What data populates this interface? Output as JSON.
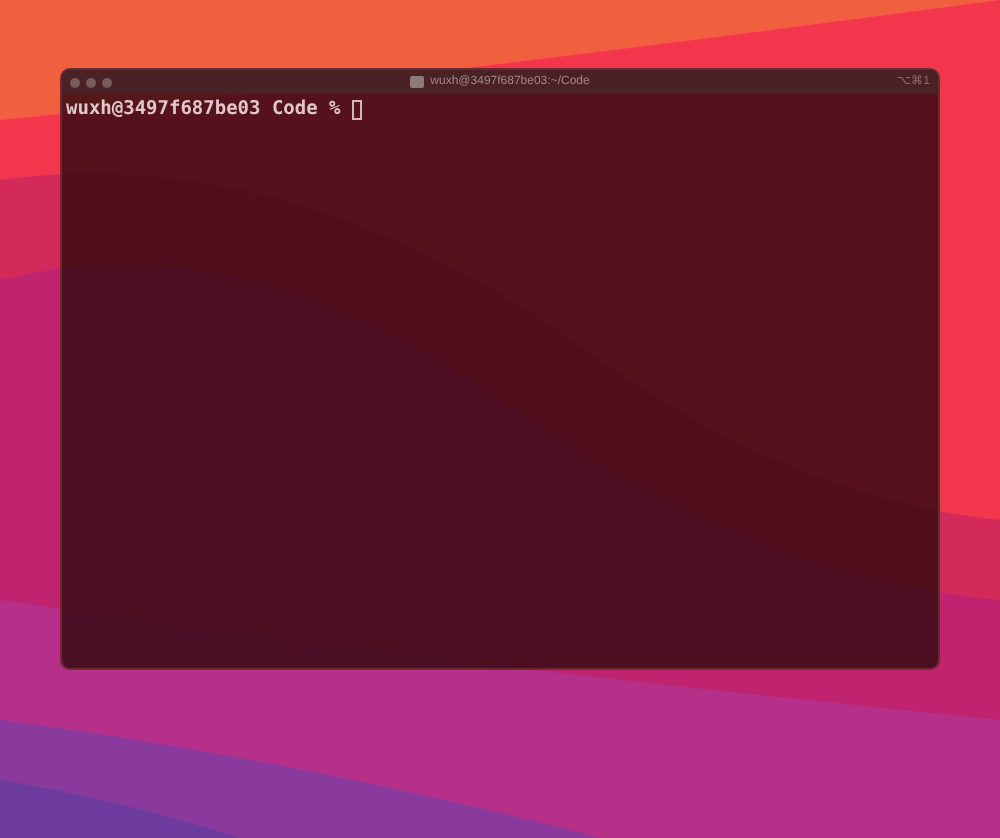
{
  "window": {
    "title": "wuxh@3497f687be03:~/Code",
    "shortcut": "⌥⌘1",
    "active": false
  },
  "terminal": {
    "prompt": "wuxh@3497f687be03 Code % ",
    "cursor": true
  }
}
